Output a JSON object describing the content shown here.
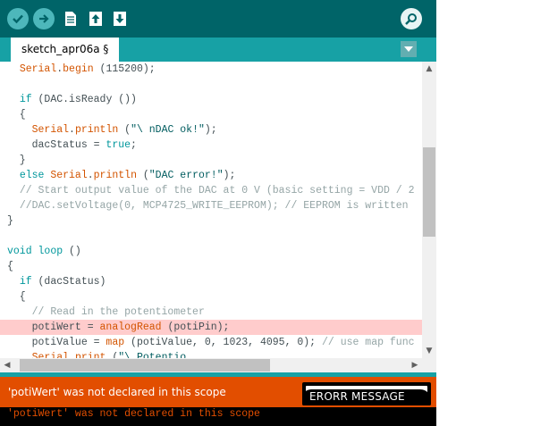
{
  "toolbar": {
    "buttons": [
      "verify-icon",
      "upload-icon",
      "new-icon",
      "open-icon",
      "save-icon",
      "serial-monitor-icon"
    ]
  },
  "tabs": [
    {
      "label": "sketch_apr06a §"
    }
  ],
  "editor": {
    "lines": [
      [
        {
          "t": "  "
        },
        {
          "t": "Serial",
          "c": "k-orange"
        },
        {
          "t": "."
        },
        {
          "t": "begin",
          "c": "k-orange"
        },
        {
          "t": " (115200);"
        }
      ],
      [
        {
          "t": ""
        }
      ],
      [
        {
          "t": "  "
        },
        {
          "t": "if",
          "c": "k-teal"
        },
        {
          "t": " (DAC.isReady ())"
        }
      ],
      [
        {
          "t": "  {"
        }
      ],
      [
        {
          "t": "    "
        },
        {
          "t": "Serial",
          "c": "k-orange"
        },
        {
          "t": "."
        },
        {
          "t": "println",
          "c": "k-orange"
        },
        {
          "t": " ("
        },
        {
          "t": "\"\\ nDAC ok!\"",
          "c": "k-string"
        },
        {
          "t": ");"
        }
      ],
      [
        {
          "t": "    dacStatus = "
        },
        {
          "t": "true",
          "c": "k-teal"
        },
        {
          "t": ";"
        }
      ],
      [
        {
          "t": "  }"
        }
      ],
      [
        {
          "t": "  "
        },
        {
          "t": "else",
          "c": "k-teal"
        },
        {
          "t": " "
        },
        {
          "t": "Serial",
          "c": "k-orange"
        },
        {
          "t": "."
        },
        {
          "t": "println",
          "c": "k-orange"
        },
        {
          "t": " ("
        },
        {
          "t": "\"DAC error!\"",
          "c": "k-string"
        },
        {
          "t": ");"
        }
      ],
      [
        {
          "t": "  "
        },
        {
          "t": "// Start output value of the DAC at 0 V (basic setting = VDD / 2",
          "c": "k-comment"
        }
      ],
      [
        {
          "t": "  "
        },
        {
          "t": "//DAC.setVoltage(0, MCP4725_WRITE_EEPROM); // EEPROM is written",
          "c": "k-comment"
        }
      ],
      [
        {
          "t": "}"
        }
      ],
      [
        {
          "t": ""
        }
      ],
      [
        {
          "t": "void",
          "c": "k-teal"
        },
        {
          "t": " "
        },
        {
          "t": "loop",
          "c": "k-teal"
        },
        {
          "t": " ()"
        }
      ],
      [
        {
          "t": "{"
        }
      ],
      [
        {
          "t": "  "
        },
        {
          "t": "if",
          "c": "k-teal"
        },
        {
          "t": " (dacStatus)"
        }
      ],
      [
        {
          "t": "  {"
        }
      ],
      [
        {
          "t": "    "
        },
        {
          "t": "// Read in the potentiometer",
          "c": "k-comment"
        }
      ],
      [
        {
          "t": "    potiWert = "
        },
        {
          "t": "analogRead",
          "c": "k-orange"
        },
        {
          "t": " (potiPin);"
        }
      ],
      [
        {
          "t": "    potiValue = "
        },
        {
          "t": "map",
          "c": "k-orange"
        },
        {
          "t": " (potiValue, 0, 1023, 4095, 0); "
        },
        {
          "t": "// use map func",
          "c": "k-comment"
        }
      ],
      [
        {
          "t": "    "
        },
        {
          "t": "Serial",
          "c": "k-orange"
        },
        {
          "t": "."
        },
        {
          "t": "print",
          "c": "k-orange"
        },
        {
          "t": " ("
        },
        {
          "t": "\"\\ Potentio",
          "c": "k-string"
        }
      ]
    ],
    "highlight_line": 17
  },
  "status": {
    "message": "'potiWert' was not declared in this scope",
    "button_label": "ERORR MESSAGE"
  },
  "console": {
    "text": "'potiWert' was not declared in this scope"
  },
  "colors": {
    "toolbar": "#006468",
    "tabbar": "#17a1a5",
    "error_bar": "#e24e00",
    "keyword_orange": "#d35400",
    "keyword_teal": "#00979c",
    "highlight": "#ffcccc"
  }
}
